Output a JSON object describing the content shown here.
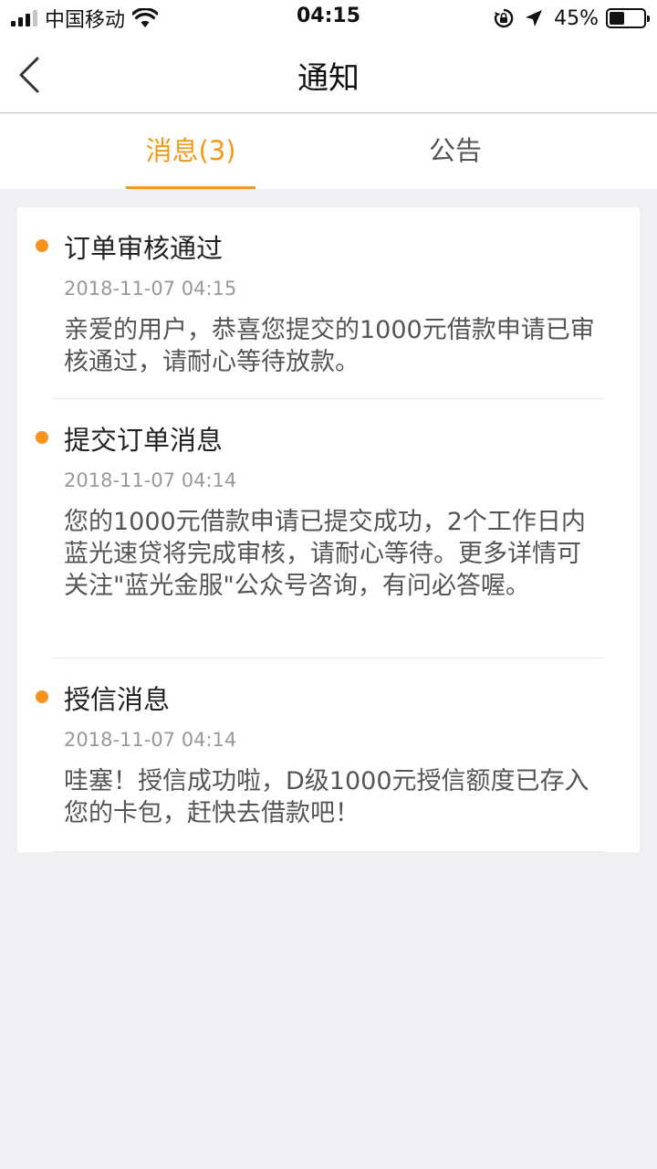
{
  "status_bar": {
    "carrier": "中国移动",
    "time": "04:15",
    "battery_percent_label": "45%",
    "battery_level": 0.45
  },
  "nav": {
    "title": "通知"
  },
  "tabs": [
    {
      "label": "消息(3)",
      "active": true
    },
    {
      "label": "公告",
      "active": false
    }
  ],
  "messages": [
    {
      "title": "订单审核通过",
      "time": "2018-11-07 04:15",
      "body": "亲爱的用户，恭喜您提交的1000元借款申请已审核通过，请耐心等待放款。"
    },
    {
      "title": "提交订单消息",
      "time": "2018-11-07 04:14",
      "body": "您的1000元借款申请已提交成功，2个工作日内蓝光速贷将完成审核，请耐心等待。更多详情可关注\"蓝光金服\"公众号咨询，有问必答喔。"
    },
    {
      "title": "授信消息",
      "time": "2018-11-07 04:14",
      "body": "哇塞！授信成功啦，D级1000元授信额度已存入您的卡包，赶快去借款吧！"
    }
  ],
  "colors": {
    "accent": "#f39a1b",
    "unread_dot": "#f7931e",
    "background": "#efeff4"
  }
}
